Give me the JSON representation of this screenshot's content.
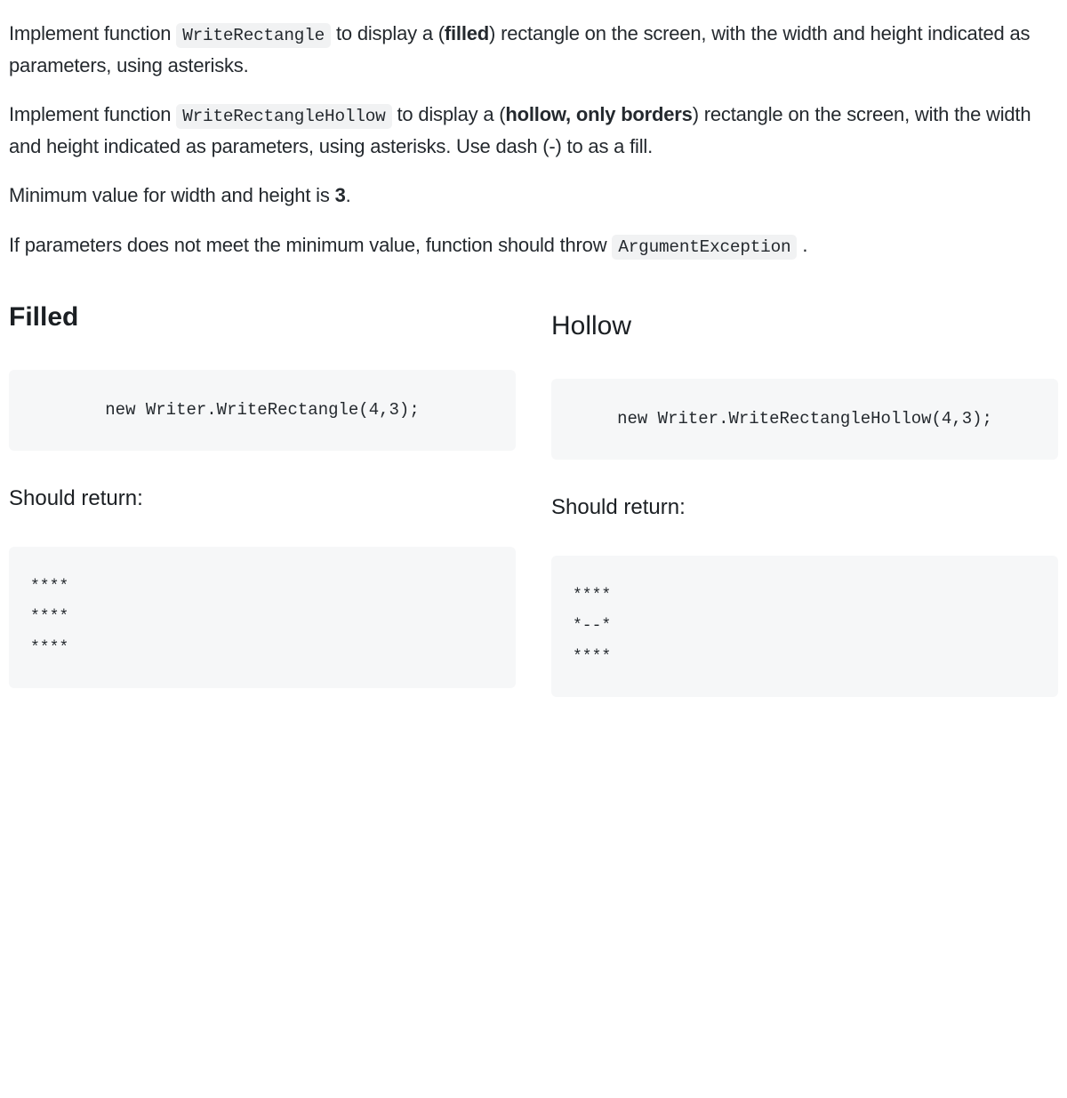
{
  "intro": {
    "p1_pre": "Implement function ",
    "p1_code": "WriteRectangle",
    "p1_mid": " to display a (",
    "p1_bold": "filled",
    "p1_post": ") rectangle on the screen, with the width and height indicated as parameters, using asterisks.",
    "p2_pre": "Implement function ",
    "p2_code": "WriteRectangleHollow",
    "p2_mid": " to display a (",
    "p2_bold": "hollow, only borders",
    "p2_post": ") rectangle on the screen, with the width and height indicated as parameters, using asterisks. Use dash (-) to as a fill.",
    "p3_pre": "Minimum value for width and height is ",
    "p3_bold": "3",
    "p3_post": ".",
    "p4_pre": "If parameters does not meet the minimum value, function should throw ",
    "p4_code": "ArgumentException",
    "p4_post": " ."
  },
  "left": {
    "heading": "Filled",
    "call": "new Writer.WriteRectangle(4,3);",
    "should_return": "Should return:",
    "output": "****\n****\n****"
  },
  "right": {
    "heading": "Hollow",
    "call": "new Writer.WriteRectangleHollow(4,3);",
    "should_return": "Should return:",
    "output": "****\n*--*\n****"
  }
}
